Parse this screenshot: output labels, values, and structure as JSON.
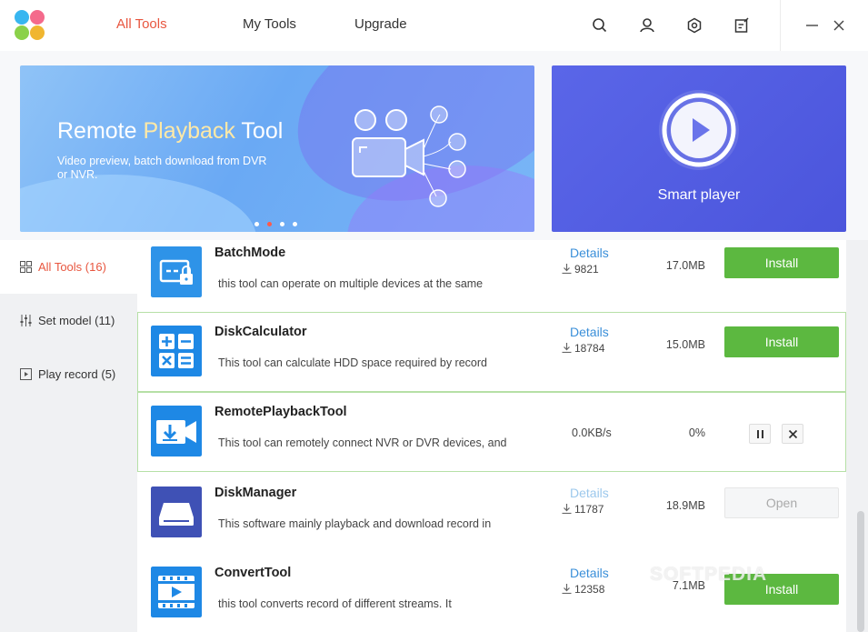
{
  "nav": {
    "tabs": [
      {
        "label": "All Tools",
        "active": true
      },
      {
        "label": "My Tools",
        "active": false
      },
      {
        "label": "Upgrade",
        "active": false
      }
    ],
    "icons": [
      "search-icon",
      "user-icon",
      "settings-icon",
      "notes-icon"
    ],
    "window_controls": [
      "minimize-icon",
      "close-icon"
    ]
  },
  "banner": {
    "title_part1": "Remote ",
    "title_highlight": "Playback",
    "title_part2": " Tool",
    "subtitle": "Video preview, batch  download from DVR or NVR.",
    "slide_count": 4,
    "active_slide": 2
  },
  "side_banner": {
    "label": "Smart player"
  },
  "sidebar": {
    "items": [
      {
        "label": "All Tools (16)",
        "icon": "grid-icon",
        "active": true
      },
      {
        "label": "Set model (11)",
        "icon": "sliders-icon",
        "active": false
      },
      {
        "label": "Play record (5)",
        "icon": "play-record-icon",
        "active": false
      }
    ]
  },
  "tools": [
    {
      "name": "BatchMode",
      "description": "this tool can operate on multiple devices at the same",
      "details": "Details",
      "downloads": "9821",
      "size": "17.0MB",
      "action": "Install"
    },
    {
      "name": "DiskCalculator",
      "description": "This tool can calculate HDD space required by record",
      "details": "Details",
      "downloads": "18784",
      "size": "15.0MB",
      "action": "Install"
    },
    {
      "name": "RemotePlaybackTool",
      "description": "This tool can remotely connect NVR or DVR devices, and",
      "speed": "0.0KB/s",
      "progress": "0%"
    },
    {
      "name": "DiskManager",
      "description": "This software mainly playback and download record in",
      "details": "Details",
      "downloads": "11787",
      "size": "18.9MB",
      "action": "Open"
    },
    {
      "name": "ConvertTool",
      "description": "this tool converts record of different streams. It",
      "details": "Details",
      "downloads": "12358",
      "size": "7.1MB",
      "action": "Install"
    }
  ],
  "watermark": "SOFTPEDIA",
  "colors": {
    "accent": "#e8563f",
    "install_green": "#5cb840",
    "link_blue": "#3a8fd9",
    "row_highlight": "#b6e0a6"
  }
}
